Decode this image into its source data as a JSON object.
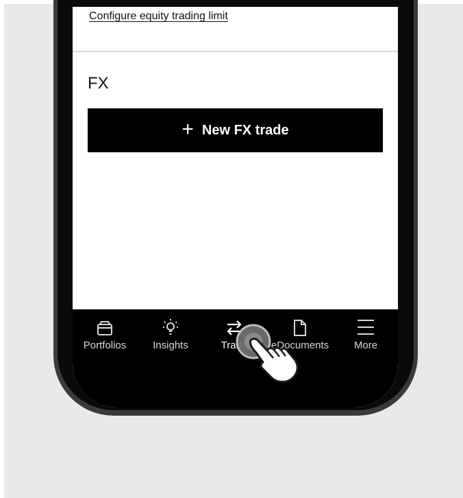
{
  "settings": {
    "configure_link": "Configure equity trading limit"
  },
  "fx_section": {
    "title": "FX",
    "new_trade_icon": "plus-icon",
    "new_trade_label": "New FX trade"
  },
  "tab_bar": {
    "active_tab": "Trade",
    "items": [
      {
        "label": "Portfolios",
        "icon": "portfolio-icon"
      },
      {
        "label": "Insights",
        "icon": "lightbulb-icon"
      },
      {
        "label": "Trade",
        "icon": "swap-arrows-icon"
      },
      {
        "label": "eDocuments",
        "icon": "document-icon"
      },
      {
        "label": "More",
        "icon": "menu-icon"
      }
    ]
  },
  "colors": {
    "background": "#e9e9e9",
    "button": "#000000",
    "tab_bar": "#000000",
    "tab_text": "#d9d9d9"
  }
}
